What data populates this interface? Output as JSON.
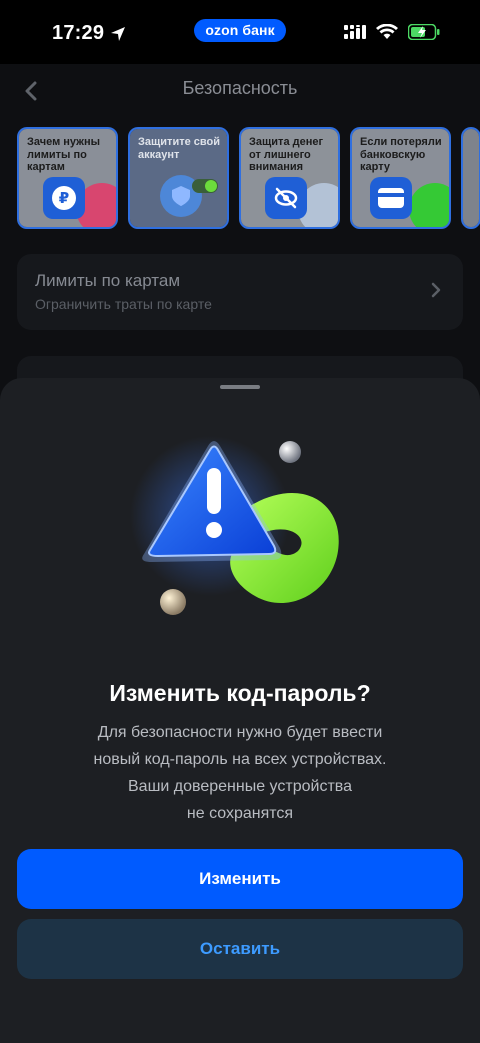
{
  "status_bar": {
    "time": "17:29",
    "brand": "ozon банк"
  },
  "nav": {
    "title": "Безопасность"
  },
  "stories": [
    {
      "text": "Зачем нужны лимиты по картам",
      "icon": "ruble-icon",
      "blob_color": "#e8456e"
    },
    {
      "text": "Защитите свой аккаунт",
      "icon": "shield-icon",
      "blob_color": "#5aa6ff"
    },
    {
      "text": "Защита денег от лишнего внимания",
      "icon": "eye-off-icon",
      "blob_color": "#a9bfe0"
    },
    {
      "text": "Если потеряли банковскую карту",
      "icon": "card-icon",
      "blob_color": "#3fd03f"
    }
  ],
  "limits_card": {
    "title": "Лимиты по картам",
    "subtitle": "Ограничить траты по карте"
  },
  "sheet": {
    "title": "Изменить код-пароль?",
    "body_lines": [
      "Для безопасности нужно будет ввести",
      "новый код-пароль на всех устройствах.",
      "Ваши доверенные устройства",
      "не сохранятся"
    ],
    "primary_label": "Изменить",
    "secondary_label": "Оставить"
  },
  "colors": {
    "accent": "#005bff",
    "secondary_bg": "#1d3346",
    "secondary_text": "#3d9bff",
    "sheet_bg": "#1d1f23",
    "illustration_green": "#7ee02f"
  }
}
